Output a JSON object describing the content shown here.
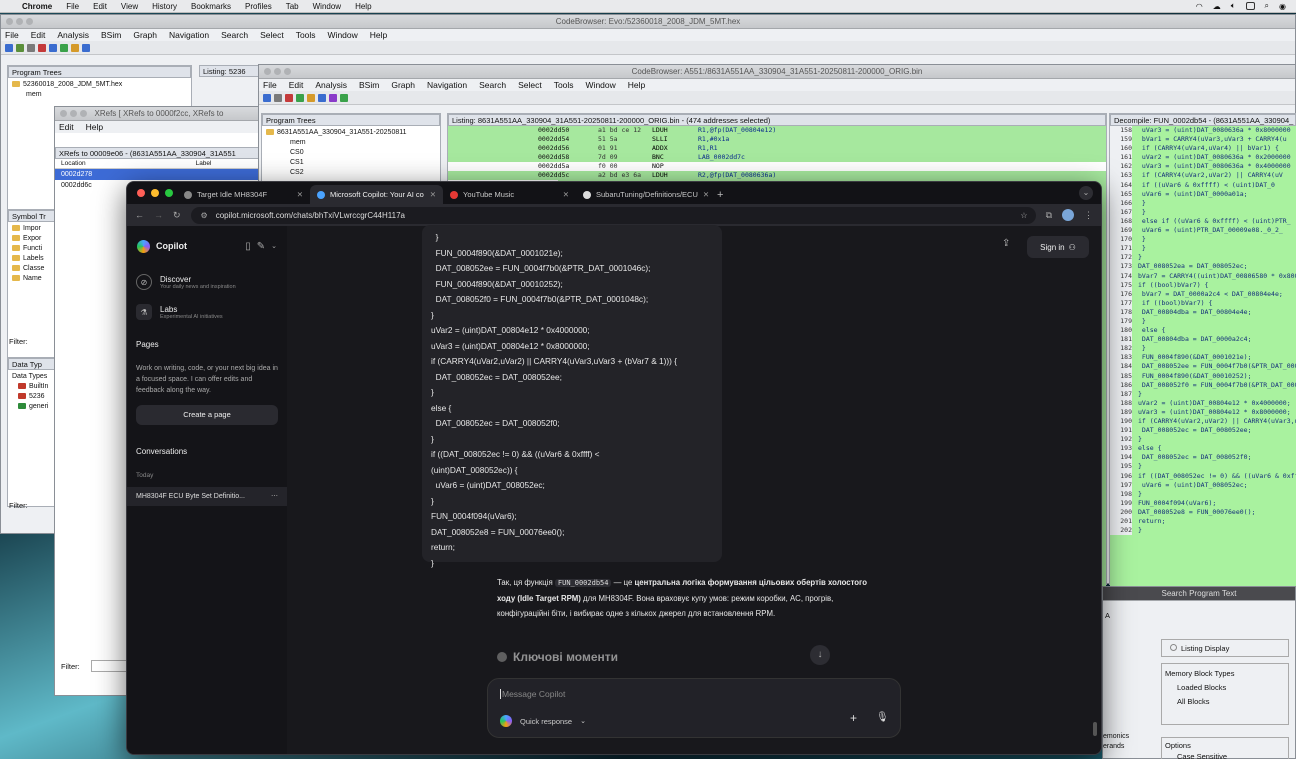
{
  "macos_menubar": {
    "app": "Chrome",
    "items": [
      "File",
      "Edit",
      "View",
      "History",
      "Bookmarks",
      "Profiles",
      "Tab",
      "Window",
      "Help"
    ]
  },
  "ghidra_back": {
    "title": "CodeBrowser: Evo:/52360018_2008_JDM_5MT.hex",
    "menu": [
      "File",
      "Edit",
      "Analysis",
      "BSim",
      "Graph",
      "Navigation",
      "Search",
      "Select",
      "Tools",
      "Window",
      "Help"
    ],
    "program_trees_title": "Program Trees",
    "tree_root": "52360018_2008_JDM_5MT.hex",
    "tree_child": "mem",
    "listing_title": "Listing: 5236",
    "symbol_tree_title": "Symbol Tr",
    "symbols": [
      "Impor",
      "Expor",
      "Functi",
      "Labels",
      "Classe",
      "Name"
    ],
    "filter_label": "Filter:",
    "data_types_title": "Data Typ",
    "data_types": [
      "Data Types",
      "BuiltIn",
      "5236",
      "generi"
    ]
  },
  "xrefs": {
    "title": "XRefs [ XRefs to 0000f2cc, XRefs to",
    "menu": [
      "Edit",
      "Help"
    ],
    "header": "XRefs to 00009e06 - (8631A551AA_330904_31A551",
    "columns": [
      "Location",
      "Label"
    ],
    "rows": [
      "0002d278",
      "0002dd6c"
    ],
    "filter_label": "Filter:"
  },
  "ghidra_front": {
    "title": "CodeBrowser: A551:/8631A551AA_330904_31A551-20250811-200000_ORIG.bin",
    "menu": [
      "File",
      "Edit",
      "Analysis",
      "BSim",
      "Graph",
      "Navigation",
      "Search",
      "Select",
      "Tools",
      "Window",
      "Help"
    ],
    "program_trees_title": "Program Trees",
    "tree_root": "8631A551AA_330904_31A551-20250811",
    "tree_children": [
      "mem",
      "CS0",
      "CS1",
      "CS2"
    ],
    "listing_title": "Listing:  8631A551AA_330904_31A551-20250811-200000_ORIG.bin - (474 addresses selected)",
    "listing_rows": [
      {
        "addr": "0002dd50",
        "bytes": "a1 bd ce 12",
        "mnem": "LDUH",
        "ops": "R1,@fp(DAT_00804e12)",
        "hl": true
      },
      {
        "addr": "0002dd54",
        "bytes": "51 5a",
        "mnem": "SLLI",
        "ops": "R1,#0x1a",
        "hl": true
      },
      {
        "addr": "0002dd56",
        "bytes": "01 91",
        "mnem": "ADDX",
        "ops": "R1,R1",
        "hl": true
      },
      {
        "addr": "0002dd58",
        "bytes": "7d 09",
        "mnem": "BNC",
        "ops": "LAB_0002dd7c",
        "hl": true
      },
      {
        "addr": "0002dd5a",
        "bytes": "f0 00",
        "mnem": "NOP",
        "ops": "",
        "hl": false
      },
      {
        "addr": "0002dd5c",
        "bytes": "a2 bd e3 6a",
        "mnem": "LDUH",
        "ops": "R2,@fp(DAT_0080636a)",
        "hl": true
      }
    ],
    "decompile_title": "Decompile: FUN_0002db54 - (8631A551AA_330904_",
    "decompile_lines": [
      {
        "n": "158",
        "t": "  uVar3 = (uint)DAT_0080636a * 0x8000000"
      },
      {
        "n": "159",
        "t": "  bVar1 = CARRY4(uVar3,uVar3 + CARRY4(u"
      },
      {
        "n": "160",
        "t": "  if (CARRY4(uVar4,uVar4) || bVar1) {"
      },
      {
        "n": "161",
        "t": "    uVar2 = (uint)DAT_0080636a * 0x2000000"
      },
      {
        "n": "162",
        "t": "    uVar3 = (uint)DAT_0080636a * 0x4000000"
      },
      {
        "n": "163",
        "t": "    if (CARRY4(uVar2,uVar2) || CARRY4(uV"
      },
      {
        "n": "164",
        "t": "      if ((uVar6 & 0xffff) < (uint)DAT_0"
      },
      {
        "n": "165",
        "t": "        uVar6 = (uint)DAT_0000a01a;"
      },
      {
        "n": "166",
        "t": "      }"
      },
      {
        "n": "167",
        "t": "    }"
      },
      {
        "n": "168",
        "t": "    else if ((uVar6 & 0xffff) < (uint)PTR_"
      },
      {
        "n": "169",
        "t": "      uVar6 = (uint)PTR_DAT_00009e08._0_2_"
      },
      {
        "n": "170",
        "t": "    }"
      },
      {
        "n": "171",
        "t": "  }"
      },
      {
        "n": "172",
        "t": "}"
      },
      {
        "n": "173",
        "t": "DAT_008052ea = DAT_008052ec;"
      },
      {
        "n": "174",
        "t": "bVar7 = CARRY4((uint)DAT_00806580 * 0x8000"
      },
      {
        "n": "175",
        "t": "if ((bool)bVar7) {"
      },
      {
        "n": "176",
        "t": "  bVar7 = DAT_0000a2c4 < DAT_00804e4e;"
      },
      {
        "n": "177",
        "t": "  if ((bool)bVar7) {"
      },
      {
        "n": "178",
        "t": "    DAT_00804dba = DAT_00804e4e;"
      },
      {
        "n": "179",
        "t": "  }"
      },
      {
        "n": "180",
        "t": "  else {"
      },
      {
        "n": "181",
        "t": "    DAT_00804dba = DAT_0000a2c4;"
      },
      {
        "n": "182",
        "t": "  }"
      },
      {
        "n": "183",
        "t": "  FUN_0004f890(&DAT_0001021e);"
      },
      {
        "n": "184",
        "t": "  DAT_008052ee = FUN_0004f7b0(&PTR_DAT_0001"
      },
      {
        "n": "185",
        "t": "  FUN_0004f890(&DAT_00010252);"
      },
      {
        "n": "186",
        "t": "  DAT_008052f0 = FUN_0004f7b0(&PTR_DAT_0001"
      },
      {
        "n": "187",
        "t": "}"
      },
      {
        "n": "188",
        "t": "uVar2 = (uint)DAT_00804e12 * 0x4000000;"
      },
      {
        "n": "189",
        "t": "uVar3 = (uint)DAT_00804e12 * 0x8000000;"
      },
      {
        "n": "190",
        "t": "if (CARRY4(uVar2,uVar2) || CARRY4(uVar3,uVa"
      },
      {
        "n": "191",
        "t": "  DAT_008052ec = DAT_008052ee;"
      },
      {
        "n": "192",
        "t": "}"
      },
      {
        "n": "193",
        "t": "else {"
      },
      {
        "n": "194",
        "t": "  DAT_008052ec = DAT_008052f0;"
      },
      {
        "n": "195",
        "t": "}"
      },
      {
        "n": "196",
        "t": "if ((DAT_008052ec != 0) && ((uVar6 & 0xfff"
      },
      {
        "n": "197",
        "t": "  uVar6 = (uint)DAT_008052ec;"
      },
      {
        "n": "198",
        "t": "}"
      },
      {
        "n": "199",
        "t": "FUN_0004f094(uVar6);"
      },
      {
        "n": "200",
        "t": "DAT_008052e8 = FUN_00076ee0();"
      },
      {
        "n": "201",
        "t": "return;"
      },
      {
        "n": "202",
        "t": "}"
      }
    ]
  },
  "search_dialog": {
    "title": "Search Program Text",
    "a_label": "A",
    "listing_display": "Listing Display",
    "memory_block_types": "Memory Block Types",
    "loaded_blocks": "Loaded Blocks",
    "all_blocks": "All Blocks",
    "options": "Options",
    "case_sensitive": "Case Sensitive",
    "left_texts": [
      "emonics",
      "erands"
    ]
  },
  "chrome": {
    "tabs": [
      {
        "label": "Target Idle MH8304F",
        "fav": "#888888"
      },
      {
        "label": "Microsoft Copilot: Your AI co",
        "fav": "#4aa3ff"
      },
      {
        "label": "YouTube Music",
        "fav": "#e53935"
      },
      {
        "label": "SubaruTuning/Definitions/ECU",
        "fav": "#dddddd"
      }
    ],
    "url": "copilot.microsoft.com/chats/bhTxiVLwrccgrC44H117a"
  },
  "copilot": {
    "brand": "Copilot",
    "discover_title": "Discover",
    "discover_sub": "Your daily news and inspiration",
    "labs_title": "Labs",
    "labs_sub": "Experimental AI initiatives",
    "pages_title": "Pages",
    "pages_text": "Work on writing, code, or your next big idea in a focused space. I can offer edits and feedback along the way.",
    "create_page": "Create a page",
    "conversations_title": "Conversations",
    "today": "Today",
    "conversation_item": "MH8304F ECU Byte Set Definitio...",
    "sign_in": "Sign in",
    "code_lines": [
      "  }",
      "  FUN_0004f890(&DAT_0001021e);",
      "  DAT_008052ee = FUN_0004f7b0(&PTR_DAT_0001046c);",
      "  FUN_0004f890(&DAT_00010252);",
      "  DAT_008052f0 = FUN_0004f7b0(&PTR_DAT_0001048c);",
      "}",
      "uVar2 = (uint)DAT_00804e12 * 0x4000000;",
      "uVar3 = (uint)DAT_00804e12 * 0x8000000;",
      "if (CARRY4(uVar2,uVar2) || CARRY4(uVar3,uVar3 + (bVar7 & 1))) {",
      "  DAT_008052ec = DAT_008052ee;",
      "}",
      "else {",
      "  DAT_008052ec = DAT_008052f0;",
      "}",
      "if ((DAT_008052ec != 0) && ((uVar6 & 0xffff) <",
      "(uint)DAT_008052ec)) {",
      "  uVar6 = (uint)DAT_008052ec;",
      "}",
      "FUN_0004f094(uVar6);",
      "DAT_008052e8 = FUN_00076ee0();",
      "return;",
      "}"
    ],
    "answer_pre": "Так, ця функція",
    "answer_code": "FUN_0002db54",
    "answer_mid": " — це ",
    "answer_bold": "центральна логіка формування цільових обертів холостого ходу (Idle Target RPM)",
    "answer_post": " для MH8304F. Вона враховує купу умов: режим коробки, AC, прогрів, конфігураційні біти, і вибирає одне з кількох джерел для встановлення RPM.",
    "key_moments": "Ключові моменти",
    "message_placeholder": "Message Copilot",
    "quick_response": "Quick response"
  }
}
